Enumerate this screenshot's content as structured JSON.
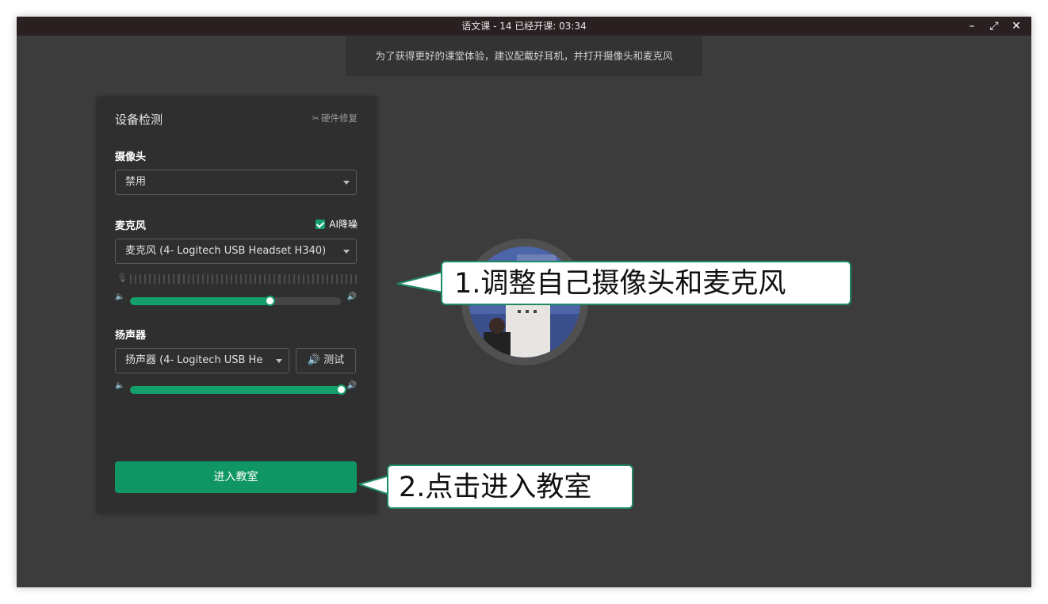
{
  "window": {
    "title": "语文课 - 14   已经开课: 03:34",
    "minimize_glyph": "–",
    "restore_glyph": "⤢",
    "close_glyph": "✕"
  },
  "banner": {
    "text": "为了获得更好的课堂体验，建议配戴好耳机，并打开摄像头和麦克风"
  },
  "panel": {
    "title": "设备检测",
    "repair_label": "硬件修复",
    "repair_icon": "wrench-icon",
    "camera": {
      "label": "摄像头",
      "selected": "禁用"
    },
    "microphone": {
      "label": "麦克风",
      "ai_noise_label": "AI降噪",
      "ai_noise_checked": true,
      "selected": "麦克风 (4- Logitech USB Headset H340)",
      "input_level": 0.0,
      "volume": 0.66
    },
    "speaker": {
      "label": "扬声器",
      "selected": "扬声器 (4- Logitech USB He",
      "test_label": "测试",
      "volume": 1.0
    },
    "enter_label": "进入教室"
  },
  "callouts": {
    "step1": "1.调整自己摄像头和麦克风",
    "step2": "2.点击进入教室"
  },
  "colors": {
    "accent": "#0f9664",
    "callout_border": "#1f8a62",
    "titlebar": "#2b2021",
    "window_bg": "#3c3c3c",
    "panel_bg": "#2f2f2f"
  }
}
